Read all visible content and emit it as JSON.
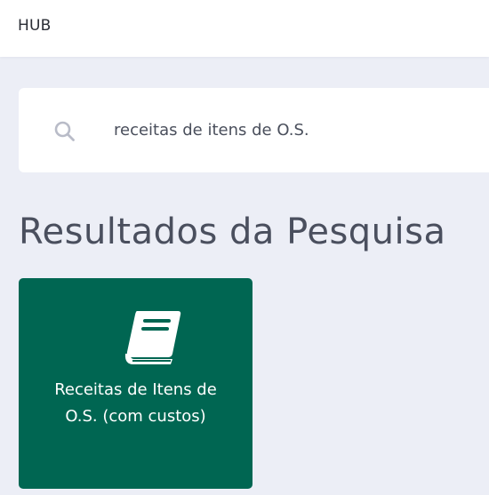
{
  "header": {
    "brand": "HUB"
  },
  "search": {
    "value": "receitas de itens de O.S.",
    "icon": "search-icon"
  },
  "main": {
    "title": "Resultados da Pesquisa",
    "results": [
      {
        "label": "Receitas de Itens de O.S. (com custos)",
        "icon": "book-icon",
        "color": "#006652"
      }
    ]
  },
  "colors": {
    "background": "#eceef6",
    "card": "#006652",
    "text": "#4a4f5e"
  }
}
